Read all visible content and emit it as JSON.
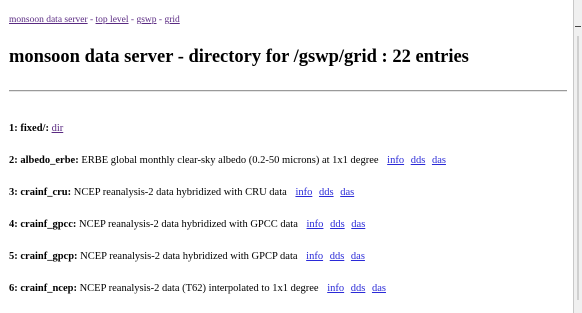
{
  "breadcrumb": {
    "items": [
      "monsoon data server",
      "top level",
      "gswp",
      "grid"
    ],
    "separator": " - "
  },
  "page_title": "monsoon data server - directory for /gswp/grid : 22 entries",
  "entries": [
    {
      "label": "1: fixed/:",
      "description": "",
      "links": [
        "dir"
      ]
    },
    {
      "label": "2: albedo_erbe:",
      "description": "ERBE global monthly clear-sky albedo (0.2-50 microns) at 1x1 degree",
      "links": [
        "info",
        "dds",
        "das"
      ]
    },
    {
      "label": "3: crainf_cru:",
      "description": "NCEP reanalysis-2 data hybridized with CRU data",
      "links": [
        "info",
        "dds",
        "das"
      ]
    },
    {
      "label": "4: crainf_gpcc:",
      "description": "NCEP reanalysis-2 data hybridized with GPCC data",
      "links": [
        "info",
        "dds",
        "das"
      ]
    },
    {
      "label": "5: crainf_gpcp:",
      "description": "NCEP reanalysis-2 data hybridized with GPCP data",
      "links": [
        "info",
        "dds",
        "das"
      ]
    },
    {
      "label": "6: crainf_ncep:",
      "description": "NCEP reanalysis-2 data (T62) interpolated to 1x1 degree",
      "links": [
        "info",
        "dds",
        "das"
      ]
    }
  ],
  "colors": {
    "visited_link": "#5a2a82",
    "link": "#2a2ad8"
  }
}
